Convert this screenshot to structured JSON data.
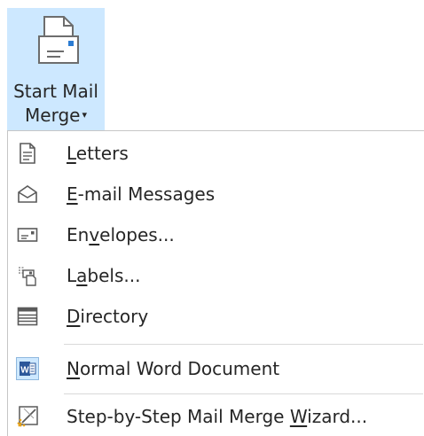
{
  "ribbon": {
    "button_line1": "Start Mail",
    "button_line2": "Merge",
    "caret": "▾",
    "icon": "start-mail-merge-icon",
    "highlight_color": "#cde8ff"
  },
  "menu": {
    "items": [
      {
        "pre": "",
        "accel": "L",
        "post": "etters",
        "icon": "letters-icon"
      },
      {
        "pre": "",
        "accel": "E",
        "post": "-mail Messages",
        "icon": "email-messages-icon"
      },
      {
        "pre": "En",
        "accel": "v",
        "post": "elopes...",
        "icon": "envelopes-icon"
      },
      {
        "pre": "L",
        "accel": "a",
        "post": "bels...",
        "icon": "labels-icon"
      },
      {
        "pre": "",
        "accel": "D",
        "post": "irectory",
        "icon": "directory-icon"
      },
      {
        "pre": "",
        "accel": "N",
        "post": "ormal Word Document",
        "icon": "word-document-icon"
      },
      {
        "pre": "Step-by-Step Mail Merge ",
        "accel": "W",
        "post": "izard...",
        "icon": "wizard-icon"
      }
    ]
  }
}
